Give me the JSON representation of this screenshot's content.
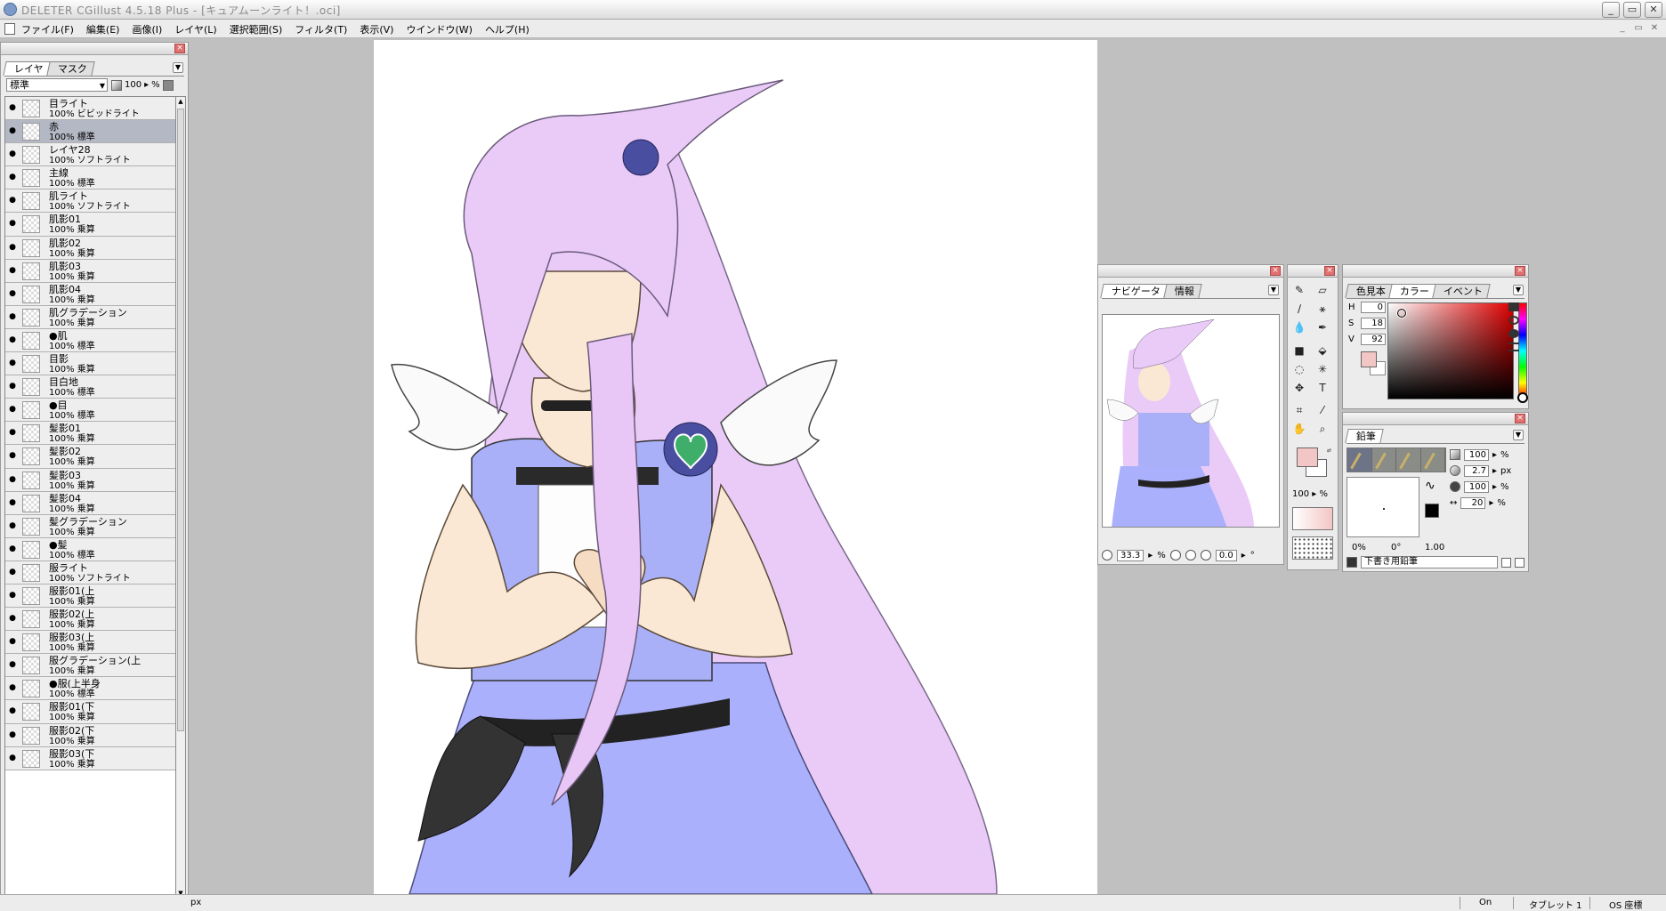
{
  "window": {
    "title": "DELETER CGillust 4.5.18 Plus - [キュアムーンライト！.oci]",
    "minimize": "_",
    "maximize": "▭",
    "close": "✕"
  },
  "menu": [
    "ファイル(F)",
    "編集(E)",
    "画像(I)",
    "レイヤ(L)",
    "選択範囲(S)",
    "フィルタ(T)",
    "表示(V)",
    "ウインドウ(W)",
    "ヘルプ(H)"
  ],
  "layer_panel": {
    "tabs": [
      "レイヤ",
      "マスク"
    ],
    "blend_mode": "標準",
    "opacity": "100",
    "opacity_unit": "%",
    "layers": [
      {
        "name": "目ライト",
        "mode": "100% ビビッドライト"
      },
      {
        "name": "赤",
        "mode": "100% 標準",
        "selected": true
      },
      {
        "name": "レイヤ28",
        "mode": "100% ソフトライト"
      },
      {
        "name": "主線",
        "mode": "100% 標準"
      },
      {
        "name": "肌ライト",
        "mode": "100% ソフトライト"
      },
      {
        "name": "肌影01",
        "mode": "100% 乗算"
      },
      {
        "name": "肌影02",
        "mode": "100% 乗算"
      },
      {
        "name": "肌影03",
        "mode": "100% 乗算"
      },
      {
        "name": "肌影04",
        "mode": "100% 乗算"
      },
      {
        "name": "肌グラデーション",
        "mode": "100% 乗算"
      },
      {
        "name": "●肌",
        "mode": "100% 標準"
      },
      {
        "name": "目影",
        "mode": "100% 乗算"
      },
      {
        "name": "目白地",
        "mode": "100% 標準"
      },
      {
        "name": "●目",
        "mode": "100% 標準"
      },
      {
        "name": "髪影01",
        "mode": "100% 乗算"
      },
      {
        "name": "髪影02",
        "mode": "100% 乗算"
      },
      {
        "name": "髪影03",
        "mode": "100% 乗算"
      },
      {
        "name": "髪影04",
        "mode": "100% 乗算"
      },
      {
        "name": "髪グラデーション",
        "mode": "100% 乗算"
      },
      {
        "name": "●髪",
        "mode": "100% 標準"
      },
      {
        "name": "服ライト",
        "mode": "100% ソフトライト"
      },
      {
        "name": "服影01(上",
        "mode": "100% 乗算"
      },
      {
        "name": "服影02(上",
        "mode": "100% 乗算"
      },
      {
        "name": "服影03(上",
        "mode": "100% 乗算"
      },
      {
        "name": "服グラデーション(上",
        "mode": "100% 乗算"
      },
      {
        "name": "●服(上半身",
        "mode": "100% 標準"
      },
      {
        "name": "服影01(下",
        "mode": "100% 乗算"
      },
      {
        "name": "服影02(下",
        "mode": "100% 乗算"
      },
      {
        "name": "服影03(下",
        "mode": "100% 乗算"
      }
    ]
  },
  "navigator": {
    "tabs": [
      "ナビゲータ",
      "情報"
    ],
    "zoom": "33.3",
    "zoom_unit": "%",
    "rotation": "0.0",
    "rotation_unit": "°"
  },
  "tool_panel": {
    "opacity": "100",
    "opacity_unit": "%",
    "text_tool": "T"
  },
  "color_panel": {
    "tabs": [
      "色見本",
      "カラー",
      "イベント"
    ],
    "h_label": "H",
    "h": "0",
    "s_label": "S",
    "s": "18",
    "v_label": "V",
    "v": "92",
    "main_color": "#f2c6c4"
  },
  "pencil_panel": {
    "tabs": [
      "鉛筆"
    ],
    "opacity": "100",
    "opacity_unit": "%",
    "size": "2.7",
    "size_unit": "px",
    "density": "100",
    "density_unit": "%",
    "spacing": "20",
    "spacing_unit": "%",
    "preview_min": "0%",
    "preview_angle": "0°",
    "preview_ratio": "1.00",
    "preset_name": "下書き用鉛筆"
  },
  "statusbar": {
    "unit": "px",
    "on": "On",
    "tablet": "タブレット 1",
    "coords": "OS 座標"
  }
}
